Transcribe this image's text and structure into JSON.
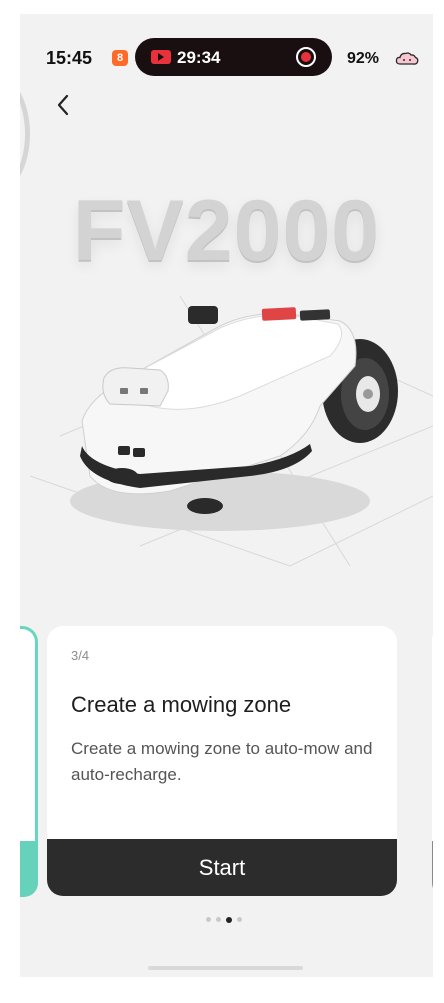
{
  "status_bar": {
    "time": "15:45",
    "notification_badge": "8",
    "recording_time": "29:34",
    "battery": "92%",
    "icons": [
      "orange-app-icon",
      "video-record-icon",
      "stop-record-icon",
      "cloud-icon"
    ]
  },
  "hero": {
    "product_name": "FV2000"
  },
  "onboarding": {
    "step": "3/4",
    "title": "Create a mowing zone",
    "description": "Create a mowing zone to auto-mow and auto-recharge.",
    "start_label": "Start",
    "pagination": {
      "total": 4,
      "current": 3
    }
  },
  "colors": {
    "accent_teal": "#66d2bb",
    "button_dark": "#2c2c2c",
    "record_red": "#e8323b"
  }
}
